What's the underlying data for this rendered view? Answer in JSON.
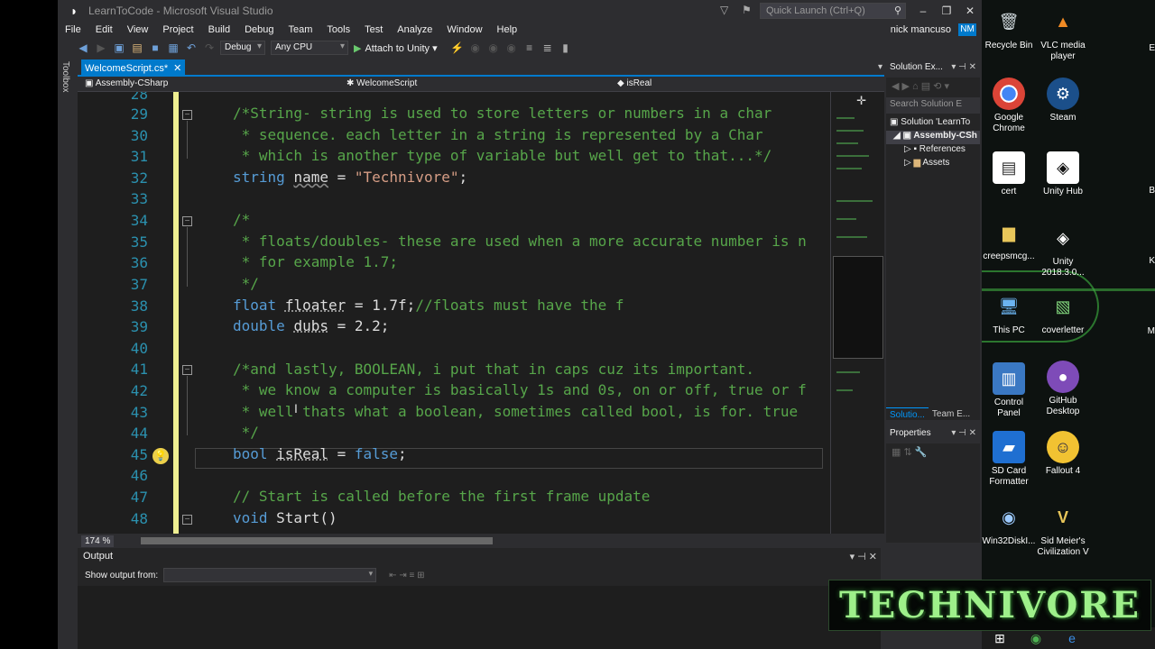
{
  "window": {
    "title": "LearnToCode - Microsoft Visual Studio",
    "quick_launch_placeholder": "Quick Launch (Ctrl+Q)",
    "user_name": "nick mancuso",
    "user_initials": "NM"
  },
  "menu": [
    "File",
    "Edit",
    "View",
    "Project",
    "Build",
    "Debug",
    "Team",
    "Tools",
    "Test",
    "Analyze",
    "Window",
    "Help"
  ],
  "toolbar": {
    "config": "Debug",
    "platform": "Any CPU",
    "attach_label": "Attach to Unity"
  },
  "toolbox_label": "Toolbox",
  "document": {
    "tab_label": "WelcomeScript.cs*",
    "nav_project": "Assembly-CSharp",
    "nav_class": "WelcomeScript",
    "nav_member": "isReal",
    "zoom": "174 %",
    "line_numbers": [
      "28",
      "29",
      "30",
      "31",
      "32",
      "33",
      "34",
      "35",
      "36",
      "37",
      "38",
      "39",
      "40",
      "41",
      "42",
      "43",
      "44",
      "45",
      "46",
      "47",
      "48"
    ]
  },
  "code": {
    "l29": "/*String- string is used to store letters or numbers in a char",
    "l30": " * sequence. each letter in a string is represented by a Char",
    "l31": " * which is another type of variable but well get to that...*/",
    "l32_kw": "string",
    "l32_id": "name",
    "l32_eq": " = ",
    "l32_str": "\"Technivore\"",
    "l32_end": ";",
    "l34": "/*",
    "l35": " * floats/doubles- these are used when a more accurate number is n",
    "l36": " * for example 1.7;",
    "l37": " */",
    "l38_kw": "float",
    "l38_id": "floater",
    "l38_rest": " = 1.7f;",
    "l38_cm": "//floats must have the f",
    "l39_kw": "double",
    "l39_id": "dubs",
    "l39_rest": " = 2.2;",
    "l41": "/*and lastly, BOOLEAN, i put that in caps cuz its important.",
    "l42": " * we know a computer is basically 1s and 0s, on or off, true or f",
    "l43": " * well thats what a boolean, sometimes called bool, is for. true",
    "l44": " */",
    "l45_kw": "bool",
    "l45_id": "isReal",
    "l45_eq": " = ",
    "l45_kw2": "false",
    "l45_end": ";",
    "l47": "// Start is called before the first frame update",
    "l48_kw": "void",
    "l48_rest": " Start()"
  },
  "solution": {
    "header": "Solution Ex...",
    "search_placeholder": "Search Solution E",
    "items": [
      "Solution 'LearnTo",
      "Assembly-CSh",
      "References",
      "Assets"
    ],
    "tabs": [
      "Solutio...",
      "Team E..."
    ]
  },
  "properties": {
    "header": "Properties"
  },
  "output": {
    "header": "Output",
    "show_from_label": "Show output from:"
  },
  "desktop": {
    "icons": [
      {
        "label": "Recycle Bin"
      },
      {
        "label": "VLC media player"
      },
      {
        "label": "Google Chrome"
      },
      {
        "label": "Steam"
      },
      {
        "label": "cert"
      },
      {
        "label": "Unity Hub"
      },
      {
        "label": "creepsmcg..."
      },
      {
        "label": "Unity 2018.3.0..."
      },
      {
        "label": "This PC"
      },
      {
        "label": "coverletter"
      },
      {
        "label": "Control Panel"
      },
      {
        "label": "GitHub Desktop"
      },
      {
        "label": "SD Card Formatter"
      },
      {
        "label": "Fallout 4"
      },
      {
        "label": "Win32DiskI..."
      },
      {
        "label": "Sid Meier's Civilization V"
      }
    ],
    "edge_letters": [
      "E",
      "B",
      "K",
      "M"
    ]
  },
  "watermark": "TECHNIVORE"
}
